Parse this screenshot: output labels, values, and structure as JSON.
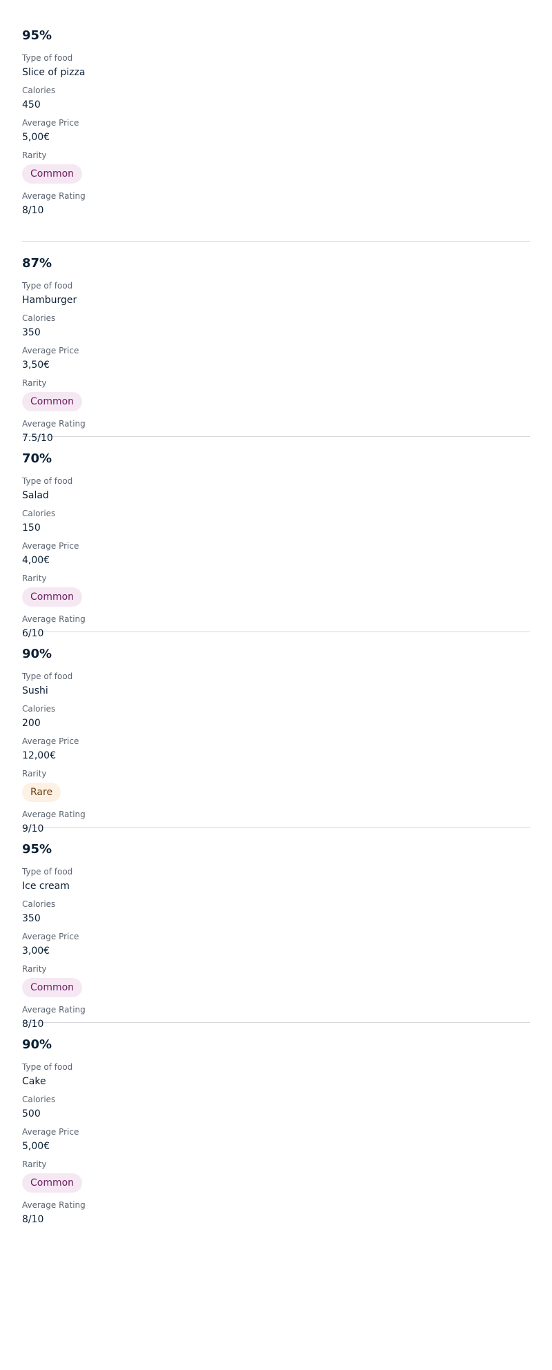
{
  "labels": {
    "type": "Type of food",
    "calories": "Calories",
    "price": "Average Price",
    "rarity": "Rarity",
    "rating": "Average Rating"
  },
  "items": [
    {
      "percent": "95%",
      "type": "Slice of pizza",
      "calories": "450",
      "price": "5,00€",
      "rarity": "Common",
      "rating": "8/10",
      "rarity_color": "#f5e8f3"
    },
    {
      "percent": "87%",
      "type": "Hamburger",
      "calories": "350",
      "price": "3,50€",
      "rarity": "Common",
      "rating": "7.5/10",
      "rarity_color": "#f5e8f3"
    },
    {
      "percent": "70%",
      "type": "Salad",
      "calories": "150",
      "price": "4,00€",
      "rarity": "Common",
      "rating": "6/10",
      "rarity_color": "#f5e8f3"
    },
    {
      "percent": "90%",
      "type": "Sushi",
      "calories": "200",
      "price": "12,00€",
      "rarity": "Rare",
      "rating": "9/10",
      "rarity_color": "#fdf1e3"
    },
    {
      "percent": "95%",
      "type": "Ice cream",
      "calories": "350",
      "price": "3,00€",
      "rarity": "Common",
      "rating": "8/10",
      "rarity_color": "#f5e8f3"
    },
    {
      "percent": "90%",
      "type": "Cake",
      "calories": "500",
      "price": "5,00€",
      "rarity": "Common",
      "rating": "8/10",
      "rarity_color": "#f5e8f3"
    }
  ]
}
